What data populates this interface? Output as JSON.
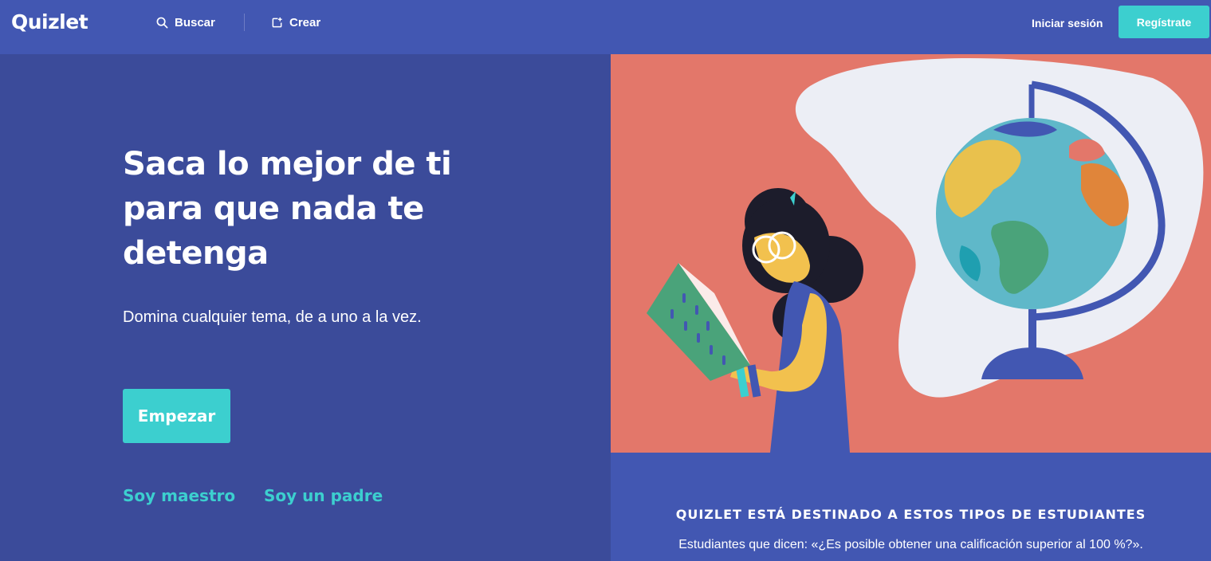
{
  "nav": {
    "logo": "Quizlet",
    "search_label": "Buscar",
    "search_icon": "search-icon",
    "create_label": "Crear",
    "create_icon": "create-icon",
    "signin_label": "Iniciar sesión",
    "signup_label": "Regístrate"
  },
  "hero": {
    "headline": "Saca lo mejor de ti para que nada te detenga",
    "subtitle": "Domina cualquier tema, de a uno a la vez.",
    "cta_label": "Empezar",
    "teacher_link": "Soy maestro",
    "parent_link": "Soy un padre"
  },
  "info": {
    "title": "QUIZLET ESTÁ DESTINADO A ESTOS TIPOS DE ESTUDIANTES",
    "quote": "Estudiantes que dicen: «¿Es posible obtener una calificación superior al 100 %?»."
  },
  "colors": {
    "nav_bg": "#4257b2",
    "hero_bg": "#3b4b9a",
    "accent": "#3ccfcf",
    "illustration_bg": "#e3776a"
  }
}
